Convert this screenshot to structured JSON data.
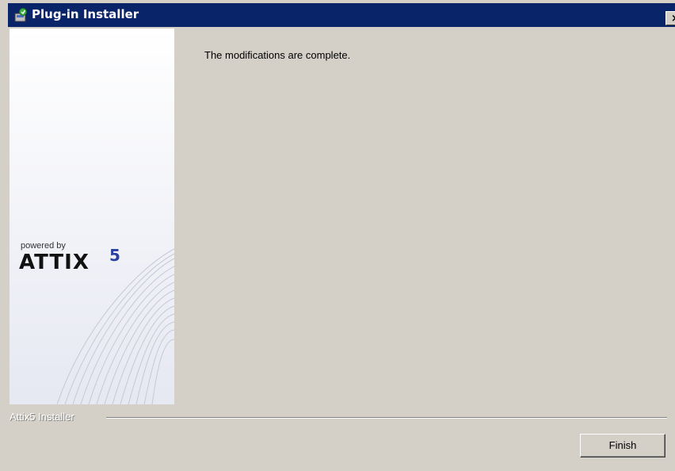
{
  "window": {
    "title": "Plug-in Installer",
    "close_glyph": "×"
  },
  "side_panel": {
    "powered_by": "powered by",
    "brand": "ATTIX",
    "brand_sup": "5"
  },
  "main": {
    "message": "The modifications are complete."
  },
  "footer": {
    "label": "Attix5 Installer",
    "finish_label": "Finish"
  },
  "colors": {
    "titlebar": "#0a246a",
    "dialog_bg": "#d4d0c8",
    "brand_accent": "#2a3fa0"
  }
}
